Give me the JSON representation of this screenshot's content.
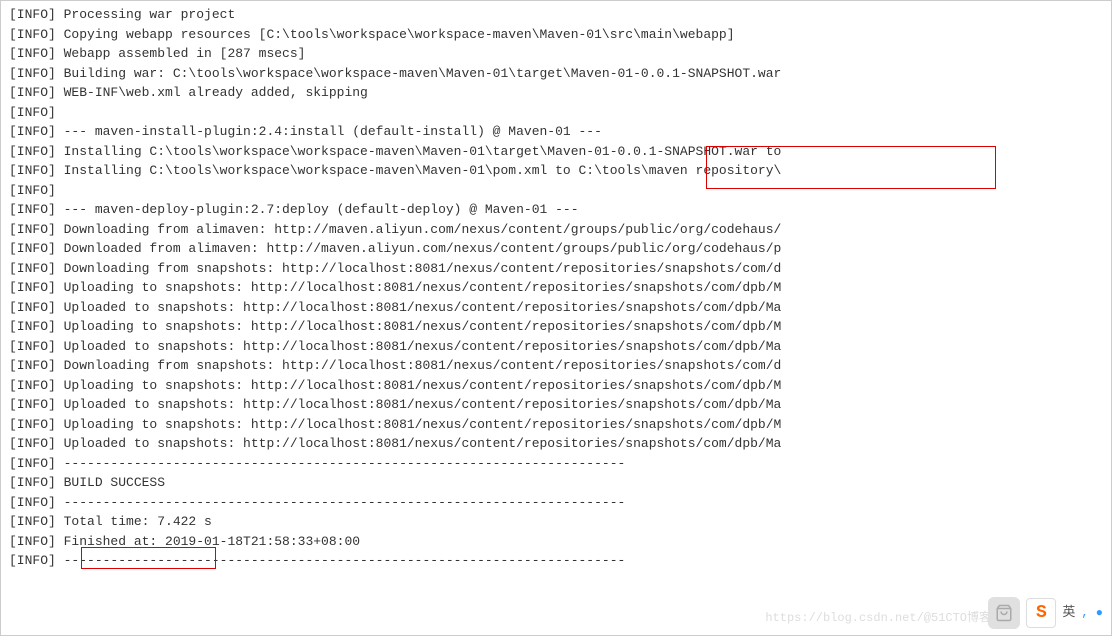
{
  "lines": [
    {
      "tag": "[INFO]",
      "msg": " Processing war project"
    },
    {
      "tag": "[INFO]",
      "msg": " Copying webapp resources [C:\\tools\\workspace\\workspace-maven\\Maven-01\\src\\main\\webapp]"
    },
    {
      "tag": "[INFO]",
      "msg": " Webapp assembled in [287 msecs]"
    },
    {
      "tag": "[INFO]",
      "msg": " Building war: C:\\tools\\workspace\\workspace-maven\\Maven-01\\target\\Maven-01-0.0.1-SNAPSHOT.war"
    },
    {
      "tag": "[INFO]",
      "msg": " WEB-INF\\web.xml already added, skipping"
    },
    {
      "tag": "[INFO]",
      "msg": ""
    },
    {
      "tag": "[INFO]",
      "msg": " --- maven-install-plugin:2.4:install (default-install) @ Maven-01 ---"
    },
    {
      "tag": "[INFO]",
      "msg": " Installing C:\\tools\\workspace\\workspace-maven\\Maven-01\\target\\Maven-01-0.0.1-SNAPSHOT.war to"
    },
    {
      "tag": "[INFO]",
      "msg": " Installing C:\\tools\\workspace\\workspace-maven\\Maven-01\\pom.xml to C:\\tools\\maven repository\\"
    },
    {
      "tag": "[INFO]",
      "msg": ""
    },
    {
      "tag": "[INFO]",
      "msg": " --- maven-deploy-plugin:2.7:deploy (default-deploy) @ Maven-01 ---"
    },
    {
      "tag": "[INFO]",
      "msg": " Downloading from alimaven: http://maven.aliyun.com/nexus/content/groups/public/org/codehaus/"
    },
    {
      "tag": "[INFO]",
      "msg": " Downloaded from alimaven: http://maven.aliyun.com/nexus/content/groups/public/org/codehaus/p"
    },
    {
      "tag": "[INFO]",
      "msg": " Downloading from snapshots: http://localhost:8081/nexus/content/repositories/snapshots/com/d"
    },
    {
      "tag": "[INFO]",
      "msg": " Uploading to snapshots: http://localhost:8081/nexus/content/repositories/snapshots/com/dpb/M"
    },
    {
      "tag": "[INFO]",
      "msg": " Uploaded to snapshots: http://localhost:8081/nexus/content/repositories/snapshots/com/dpb/Ma"
    },
    {
      "tag": "[INFO]",
      "msg": " Uploading to snapshots: http://localhost:8081/nexus/content/repositories/snapshots/com/dpb/M"
    },
    {
      "tag": "[INFO]",
      "msg": " Uploaded to snapshots: http://localhost:8081/nexus/content/repositories/snapshots/com/dpb/Ma"
    },
    {
      "tag": "[INFO]",
      "msg": " Downloading from snapshots: http://localhost:8081/nexus/content/repositories/snapshots/com/d"
    },
    {
      "tag": "[INFO]",
      "msg": " Uploading to snapshots: http://localhost:8081/nexus/content/repositories/snapshots/com/dpb/M"
    },
    {
      "tag": "[INFO]",
      "msg": " Uploaded to snapshots: http://localhost:8081/nexus/content/repositories/snapshots/com/dpb/Ma"
    },
    {
      "tag": "[INFO]",
      "msg": " Uploading to snapshots: http://localhost:8081/nexus/content/repositories/snapshots/com/dpb/M"
    },
    {
      "tag": "[INFO]",
      "msg": " Uploaded to snapshots: http://localhost:8081/nexus/content/repositories/snapshots/com/dpb/Ma"
    },
    {
      "tag": "[INFO]",
      "msg": " ------------------------------------------------------------------------"
    },
    {
      "tag": "[INFO]",
      "msg": " BUILD SUCCESS"
    },
    {
      "tag": "[INFO]",
      "msg": " ------------------------------------------------------------------------"
    },
    {
      "tag": "[INFO]",
      "msg": " Total time:  7.422 s"
    },
    {
      "tag": "[INFO]",
      "msg": " Finished at: 2019-01-18T21:58:33+08:00"
    },
    {
      "tag": "[INFO]",
      "msg": " ------------------------------------------------------------------------"
    }
  ],
  "watermark": "https://blog.csdn.net/@51CTO博客",
  "ime": {
    "letter": "S",
    "label": "英",
    "dots": ", ●"
  }
}
